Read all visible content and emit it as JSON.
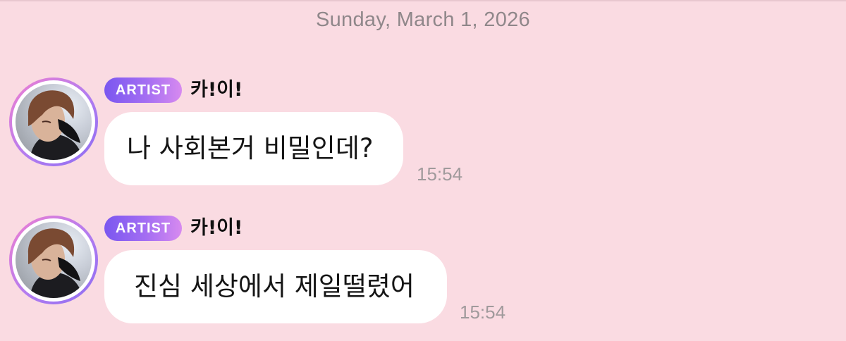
{
  "date_separator": "Sunday, March 1, 2026",
  "colors": {
    "background": "#fadbe2",
    "bubble": "#ffffff",
    "badge_gradient_start": "#7a57f0",
    "badge_gradient_end": "#d78af0",
    "timestamp": "#a09a9c"
  },
  "messages": [
    {
      "badge": "ARTIST",
      "sender": "카!이!",
      "avatar": "artist-avatar-photo",
      "text": "나 사회본거 비밀인데?",
      "time": "15:54"
    },
    {
      "badge": "ARTIST",
      "sender": "카!이!",
      "avatar": "artist-avatar-photo",
      "text": "진심 세상에서 제일떨렸어",
      "time": "15:54"
    }
  ]
}
